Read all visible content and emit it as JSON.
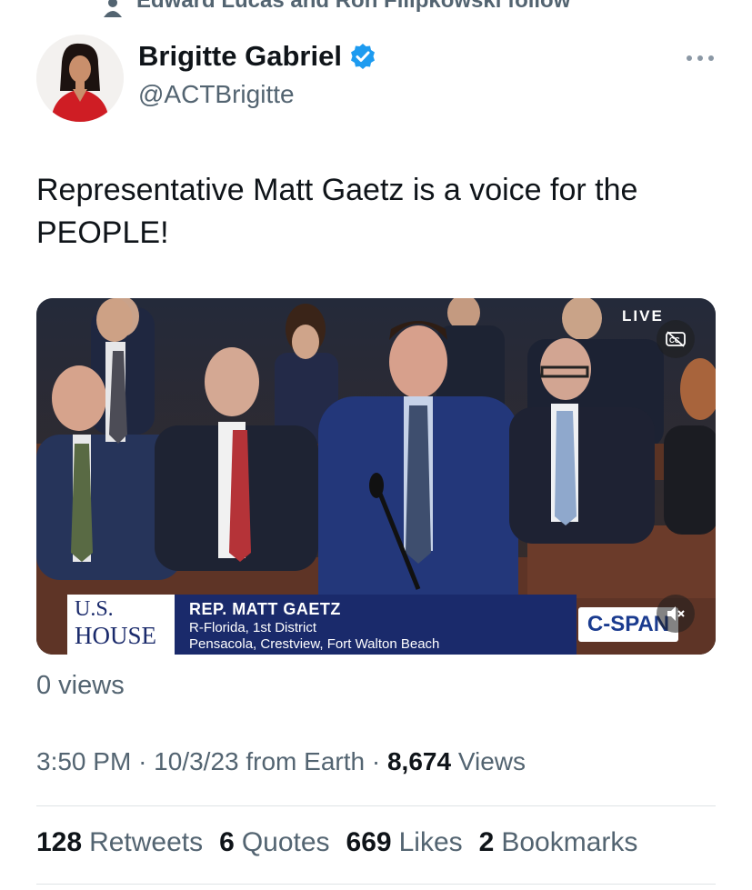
{
  "social_context": {
    "text": "Edward Lucas and Ron Filipkowski follow",
    "icon": "person-icon"
  },
  "author": {
    "display_name": "Brigitte Gabriel",
    "handle": "@ACTBrigitte",
    "verified": true,
    "verified_color": "#1d9bf0"
  },
  "more_icon": "more-horizontal-icon",
  "tweet": {
    "text": "Representative Matt Gaetz is a voice for the PEOPLE!"
  },
  "video": {
    "live_label": "LIVE",
    "cc_icon": "captions-off-icon",
    "mute_icon": "muted-speaker-icon",
    "lower_third": {
      "logo_line1": "U.S.",
      "logo_line2": "HOUSE",
      "name": "REP. MATT GAETZ",
      "party": "R-Florida, 1st District",
      "cities": "Pensacola, Crestview, Fort Walton Beach"
    },
    "network_logo": "C-SPAN"
  },
  "view_count": "0 views",
  "meta": {
    "time": "3:50 PM",
    "date": "10/3/23",
    "source": "from Earth",
    "views_number": "8,674",
    "views_label": "Views"
  },
  "stats": [
    {
      "number": "128",
      "label": "Retweets"
    },
    {
      "number": "6",
      "label": "Quotes"
    },
    {
      "number": "669",
      "label": "Likes"
    },
    {
      "number": "2",
      "label": "Bookmarks"
    }
  ],
  "colors": {
    "text_primary": "#0f1419",
    "text_secondary": "#536471",
    "divider": "#dfe3e6",
    "cspan_blue": "#1a3b8f"
  }
}
